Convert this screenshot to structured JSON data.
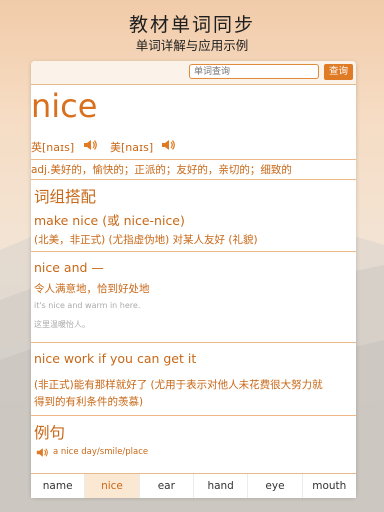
{
  "banner": {
    "title": "教材单词同步",
    "subtitle": "单词详解与应用示例"
  },
  "search": {
    "placeholder": "单词查询",
    "button_label": "查询"
  },
  "entry": {
    "word": "nice",
    "uk_label": "英[naɪs]",
    "us_label": "美[naɪs]",
    "definition": "adj.美好的，愉快的；正派的；友好的，亲切的；细致的"
  },
  "phrases_section": {
    "heading": "词组搭配"
  },
  "phrases": [
    {
      "title": "make nice (或 nice-nice)",
      "desc": "(北美，非正式) (尤指虚伪地) 对某人友好 (礼貌)"
    },
    {
      "title": "nice and —",
      "desc": "令人满意地，恰到好处地",
      "example_en": "it's nice and warm in here.",
      "example_cn": "这里温暖怡人。"
    },
    {
      "title": "nice work if you can get it",
      "desc_line1": "(非正式)能有那样就好了 (尤用于表示对他人未花费很大努力就",
      "desc_line2": "得到的有利条件的羡慕)"
    }
  ],
  "examples_section": {
    "heading": "例句"
  },
  "examples": [
    {
      "text": "a nice day/smile/place"
    }
  ],
  "tabs": [
    "name",
    "nice",
    "ear",
    "hand",
    "eye",
    "mouth"
  ],
  "active_tab": "nice",
  "colors": {
    "accent": "#e07b25",
    "text_accent": "#c86818",
    "tab_active_bg": "#fbe8d3"
  },
  "icons": {
    "speaker": "speaker-icon"
  }
}
